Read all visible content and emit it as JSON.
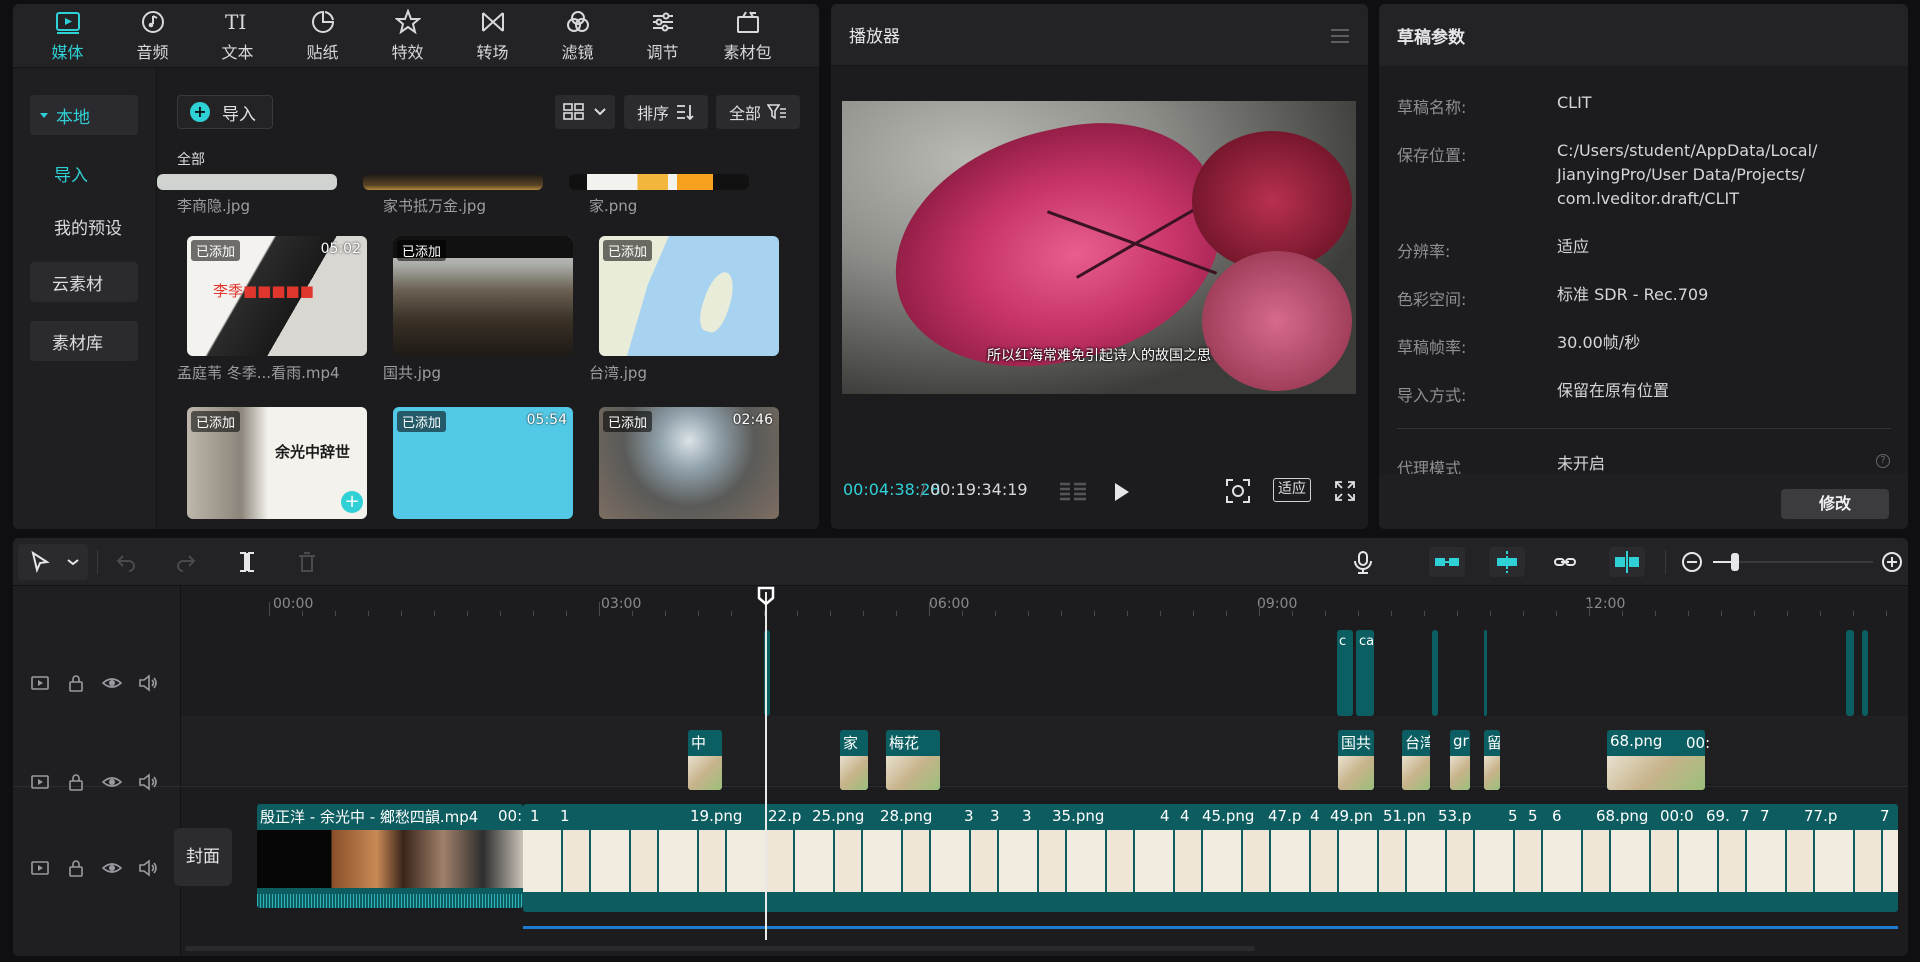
{
  "nav": {
    "items": [
      {
        "label": "媒体",
        "icon": "media-icon"
      },
      {
        "label": "音频",
        "icon": "audio-icon"
      },
      {
        "label": "文本",
        "icon": "text-icon"
      },
      {
        "label": "贴纸",
        "icon": "sticker-icon"
      },
      {
        "label": "特效",
        "icon": "effects-icon"
      },
      {
        "label": "转场",
        "icon": "transition-icon"
      },
      {
        "label": "滤镜",
        "icon": "filter-icon"
      },
      {
        "label": "调节",
        "icon": "adjust-icon"
      },
      {
        "label": "素材包",
        "icon": "package-icon"
      }
    ]
  },
  "sidebar": {
    "local": "本地",
    "import": "导入",
    "presets": "我的预设",
    "cloud": "云素材",
    "library": "素材库"
  },
  "media": {
    "import_label": "导入",
    "sort_label": "排序",
    "filter_label": "全部",
    "section_label": "全部",
    "added_badge": "已添加",
    "top_row_names": [
      "李商隐.jpg",
      "家书抵万金.jpg",
      "家.png"
    ],
    "items": [
      {
        "name": "孟庭苇 冬季...看雨.mp4",
        "duration": "05:02",
        "added": true
      },
      {
        "name": "国共.jpg",
        "duration": "",
        "added": true
      },
      {
        "name": "台湾.jpg",
        "duration": "",
        "added": true
      },
      {
        "name": "",
        "duration": "",
        "added": true
      },
      {
        "name": "",
        "duration": "05:54",
        "added": true
      },
      {
        "name": "",
        "duration": "02:46",
        "added": true
      }
    ],
    "thumb_text": "余光中辞世"
  },
  "player": {
    "title": "播放器",
    "subtitle": "所以红海常难免引起诗人的故国之思",
    "current_time": "00:04:38:28",
    "separator": "/",
    "total_time": "00:19:34:19",
    "fit_label": "适应"
  },
  "params": {
    "title": "草稿参数",
    "rows": [
      {
        "label": "草稿名称:",
        "value": "CLIT"
      },
      {
        "label": "保存位置:",
        "value": "C:/Users/student/AppData/Local/\nJianyingPro/User Data/Projects/\ncom.lveditor.draft/CLIT"
      },
      {
        "label": "分辨率:",
        "value": "适应"
      },
      {
        "label": "色彩空间:",
        "value": "标准 SDR - Rec.709"
      },
      {
        "label": "草稿帧率:",
        "value": "30.00帧/秒"
      },
      {
        "label": "导入方式:",
        "value": "保留在原有位置"
      },
      {
        "label": "代理模式",
        "value": "未开启"
      }
    ],
    "modify_label": "修改"
  },
  "timeline": {
    "ruler": [
      "00:00",
      "03:00",
      "06:00",
      "09:00",
      "12:00"
    ],
    "cover_label": "封面",
    "main_clip_name": "殷正洋 - 余光中 - 鄉愁四韻.mp4",
    "main_clip_labels": [
      "00:",
      "1",
      "1",
      "19.png",
      "22.p",
      "25.png",
      "28.png",
      "3",
      "3",
      "3",
      "35.png",
      "4",
      "4",
      "45.png",
      "47.p",
      "4",
      "49.pn",
      "51.pn",
      "53.p",
      "5",
      "5",
      "6",
      "68.png",
      "00:0",
      "69.",
      "7",
      "7",
      "77.p",
      "7"
    ],
    "overlay_labels": [
      "中",
      "家",
      "梅花",
      "国共",
      "台湾",
      "gr",
      "留",
      "68.png",
      "00:"
    ],
    "top_labels": [
      "c",
      "ca"
    ]
  },
  "colors": {
    "accent": "#2fd1d6",
    "clip": "#0b5f62",
    "panel": "#1c1c1f"
  }
}
